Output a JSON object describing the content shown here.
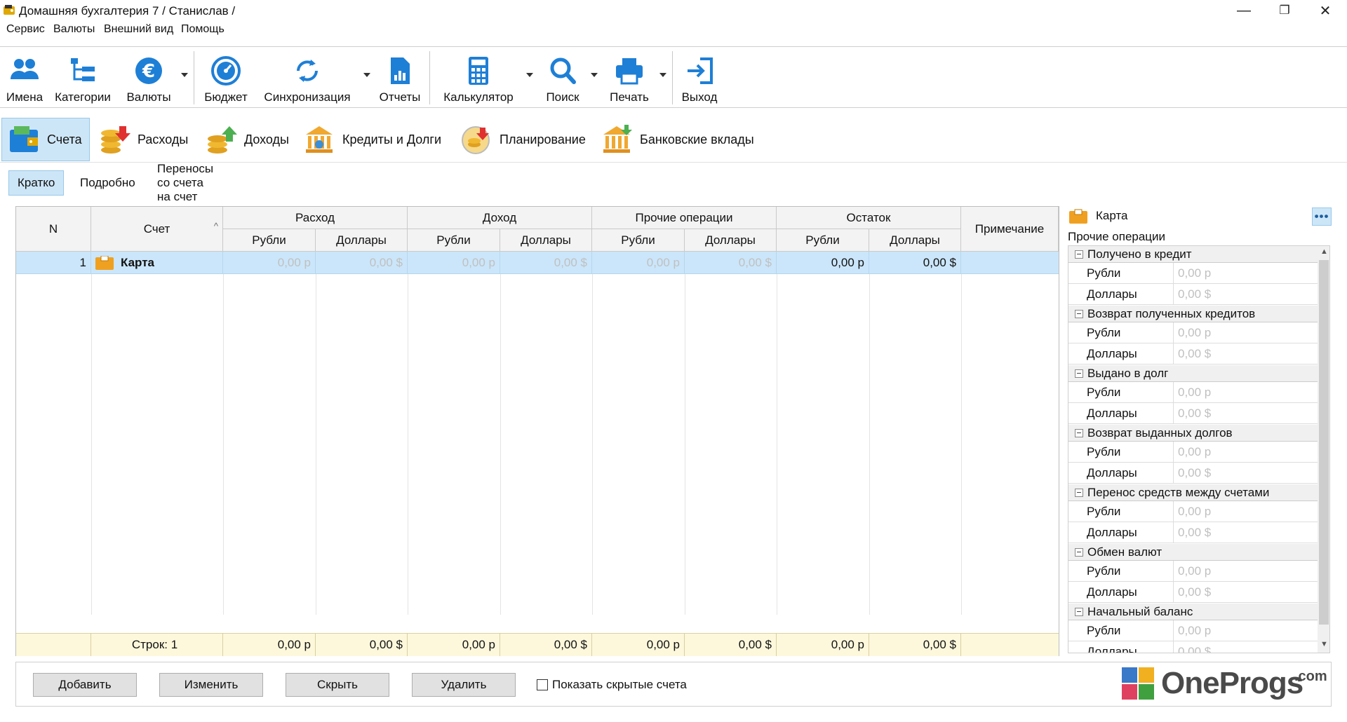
{
  "window": {
    "title": "Домашняя бухгалтерия 7  / Станислав /",
    "minimize": "—",
    "restore": "❐",
    "close": "✕"
  },
  "menu": [
    "Сервис",
    "Валюты",
    "Внешний вид",
    "Помощь"
  ],
  "toolbar": {
    "names": "Имена",
    "categories": "Категории",
    "currencies": "Валюты",
    "budget": "Бюджет",
    "sync": "Синхронизация",
    "reports": "Отчеты",
    "calculator": "Калькулятор",
    "search": "Поиск",
    "print": "Печать",
    "exit": "Выход"
  },
  "nav": {
    "accounts": "Счета",
    "expenses": "Расходы",
    "income": "Доходы",
    "loans": "Кредиты и Долги",
    "planning": "Планирование",
    "deposits": "Банковские вклады"
  },
  "subtabs": {
    "brief": "Кратко",
    "detailed": "Подробно",
    "transfers": "Переносы со счета на счет"
  },
  "grid": {
    "headers": {
      "n": "N",
      "account": "Счет",
      "expense": "Расход",
      "income": "Доход",
      "other": "Прочие операции",
      "balance": "Остаток",
      "note": "Примечание",
      "rub": "Рубли",
      "usd": "Доллары"
    },
    "rows": [
      {
        "n": "1",
        "name": "Карта",
        "exp_rub": "0,00 р",
        "exp_usd": "0,00 $",
        "inc_rub": "0,00 р",
        "inc_usd": "0,00 $",
        "oth_rub": "0,00 р",
        "oth_usd": "0,00 $",
        "bal_rub": "0,00 р",
        "bal_usd": "0,00 $",
        "note": ""
      }
    ],
    "footer": {
      "count": "Строк: 1",
      "exp_rub": "0,00 р",
      "exp_usd": "0,00 $",
      "inc_rub": "0,00 р",
      "inc_usd": "0,00 $",
      "oth_rub": "0,00 р",
      "oth_usd": "0,00 $",
      "bal_rub": "0,00 р",
      "bal_usd": "0,00 $"
    }
  },
  "side": {
    "account": "Карта",
    "section": "Прочие операции",
    "rub_label": "Рубли",
    "usd_label": "Доллары",
    "rub_value": "0,00 р",
    "usd_value": "0,00 $",
    "groups": [
      "Получено в кредит",
      "Возврат полученных кредитов",
      "Выдано в долг",
      "Возврат выданных долгов",
      "Перенос средств между счетами",
      "Обмен валют",
      "Начальный баланс"
    ]
  },
  "buttons": {
    "add": "Добавить",
    "edit": "Изменить",
    "hide": "Скрыть",
    "delete": "Удалить",
    "show_hidden": "Показать скрытые счета"
  },
  "logo": {
    "brand": "OneProgs",
    "suffix": ".com"
  },
  "colors": {
    "accent": "#1e7fd6",
    "selection": "#cde6f7",
    "footer": "#fdf8dc",
    "row_selected": "#cbe6fa"
  }
}
